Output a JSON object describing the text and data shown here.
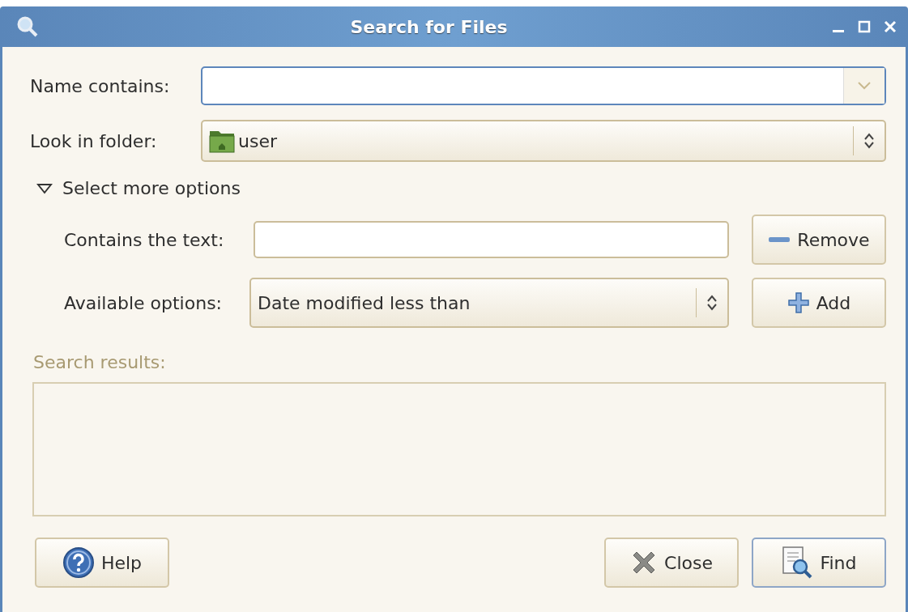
{
  "window": {
    "title": "Search for Files"
  },
  "name_field": {
    "label": "Name contains:"
  },
  "folder_field": {
    "label": "Look in folder:",
    "value": "user"
  },
  "expander": {
    "label": "Select more options",
    "expanded": true
  },
  "options": [
    {
      "kind": "text",
      "label": "Contains the text:",
      "button": "Remove"
    },
    {
      "kind": "combo",
      "label": "Available options:",
      "value": "Date modified less than",
      "button": "Add"
    }
  ],
  "results": {
    "label": "Search results:",
    "disabled": true
  },
  "buttons": [
    {
      "kind": "help",
      "label": "Help"
    },
    {
      "kind": "close",
      "label": "Close"
    },
    {
      "kind": "find",
      "label": "Find",
      "selected": true
    }
  ]
}
